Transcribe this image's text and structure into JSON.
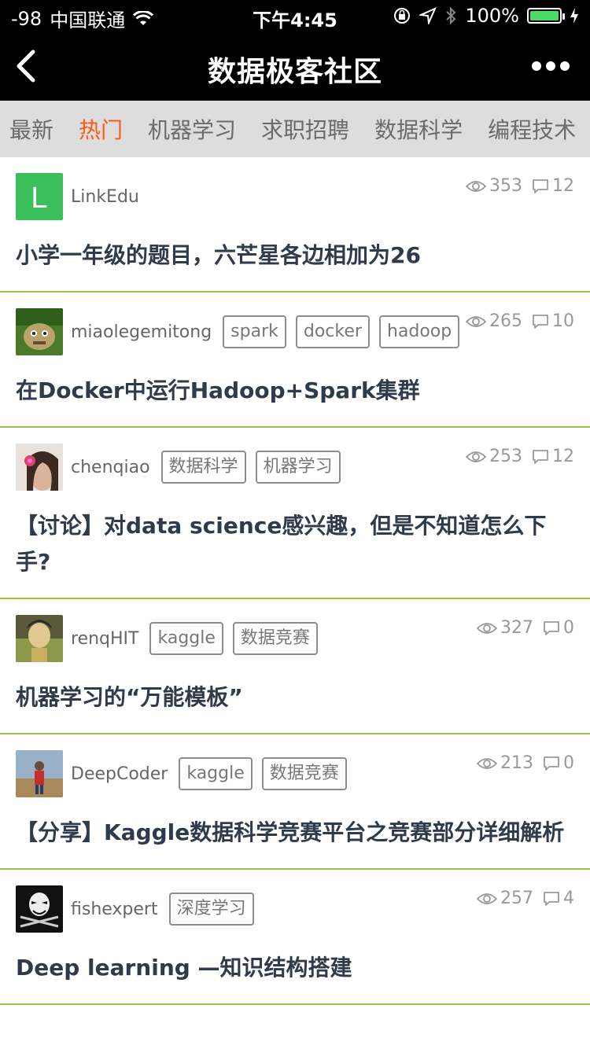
{
  "status": {
    "signal": "-98",
    "carrier": "中国联通",
    "time": "下午4:45",
    "battery": "100%"
  },
  "nav": {
    "title": "数据极客社区"
  },
  "tabs": [
    {
      "label": "最新",
      "active": false
    },
    {
      "label": "热门",
      "active": true
    },
    {
      "label": "机器学习",
      "active": false
    },
    {
      "label": "求职招聘",
      "active": false
    },
    {
      "label": "数据科学",
      "active": false
    },
    {
      "label": "编程技术",
      "active": false
    }
  ],
  "posts": [
    {
      "user": "LinkEdu",
      "tags": [],
      "views": "353",
      "comments": "12",
      "title": "小学一年级的题目，六芒星各边相加为26",
      "avatar": "L"
    },
    {
      "user": "miaolegemitong",
      "tags": [
        "spark",
        "docker",
        "hadoop"
      ],
      "views": "265",
      "comments": "10",
      "title": "在Docker中运行Hadoop+Spark集群"
    },
    {
      "user": "chenqiao",
      "tags": [
        "数据科学",
        "机器学习"
      ],
      "views": "253",
      "comments": "12",
      "title": "【讨论】对data science感兴趣，但是不知道怎么下手?"
    },
    {
      "user": "renqHIT",
      "tags": [
        "kaggle",
        "数据竞赛"
      ],
      "views": "327",
      "comments": "0",
      "title": "机器学习的“万能模板”"
    },
    {
      "user": "DeepCoder",
      "tags": [
        "kaggle",
        "数据竞赛"
      ],
      "views": "213",
      "comments": "0",
      "title": "【分享】Kaggle数据科学竞赛平台之竞赛部分详细解析"
    },
    {
      "user": "fishexpert",
      "tags": [
        "深度学习"
      ],
      "views": "257",
      "comments": "4",
      "title": "Deep learning —知识结构搭建"
    }
  ],
  "colors": {
    "accent": "#ff5a13",
    "divider": "#9bc53d",
    "linkedu": "#3bbf5a"
  }
}
